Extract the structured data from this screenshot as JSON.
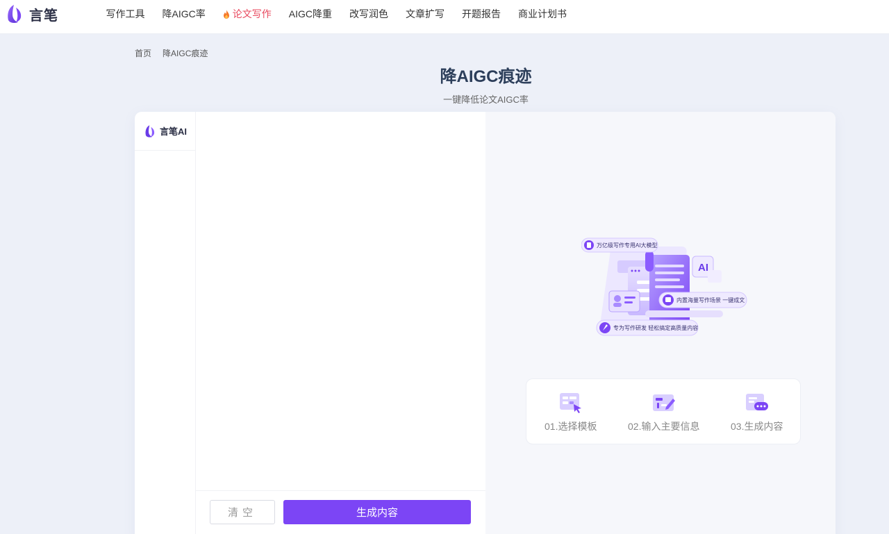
{
  "brand": {
    "name": "言笔",
    "side_name": "言笔AI"
  },
  "nav": [
    {
      "label": "写作工具",
      "active": false
    },
    {
      "label": "降AIGC率",
      "active": false
    },
    {
      "label": "论文写作",
      "active": true
    },
    {
      "label": "AIGC降重",
      "active": false
    },
    {
      "label": "改写润色",
      "active": false
    },
    {
      "label": "文章扩写",
      "active": false
    },
    {
      "label": "开题报告",
      "active": false
    },
    {
      "label": "商业计划书",
      "active": false
    }
  ],
  "breadcrumb": [
    "首页",
    "降AIGC痕迹"
  ],
  "page": {
    "title": "降AIGC痕迹",
    "subtitle": "一键降低论文AIGC率"
  },
  "editor": {
    "clear_label": "清空",
    "generate_label": "生成内容"
  },
  "illustration": {
    "tag1": "万亿级写作专用AI大模型",
    "tag2": "内置海量写作场景 一键成文",
    "tag3": "专为写作研发 轻松搞定高质量内容",
    "ai_badge": "AI"
  },
  "steps": [
    "01.选择模板",
    "02.输入主要信息",
    "03.生成内容"
  ],
  "colors": {
    "accent": "#7c45f5",
    "active_nav": "#e8485e",
    "title": "#2c3e5a"
  }
}
